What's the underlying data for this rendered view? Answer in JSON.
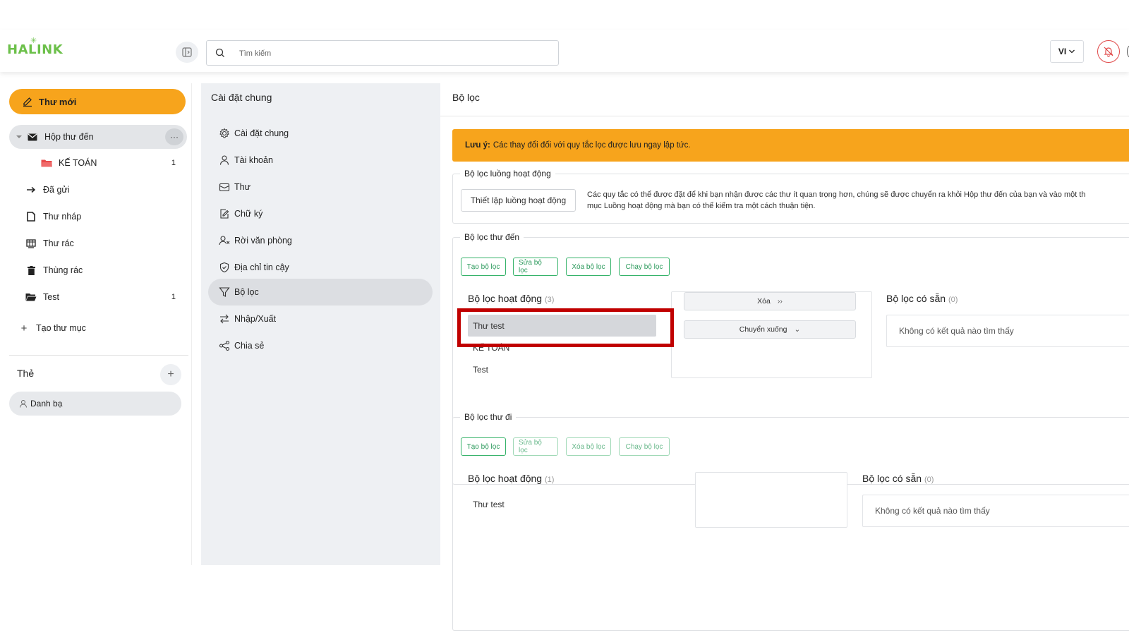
{
  "header": {
    "logo": "HALINK",
    "search_placeholder": "Tìm kiếm",
    "language": "VI"
  },
  "sidebar": {
    "new_mail": "Thư mới",
    "items": [
      {
        "label": "Hộp thư đến",
        "icon": "inbox-icon",
        "count": ""
      },
      {
        "label": "KẾ TOÁN",
        "icon": "folder-icon",
        "count": "1"
      },
      {
        "label": "Đã gửi",
        "icon": "sent-arrow-icon",
        "count": ""
      },
      {
        "label": "Thư nháp",
        "icon": "draft-icon",
        "count": ""
      },
      {
        "label": "Thư rác",
        "icon": "spam-icon",
        "count": ""
      },
      {
        "label": "Thùng rác",
        "icon": "trash-icon",
        "count": ""
      },
      {
        "label": "Test",
        "icon": "folder-open-icon",
        "count": "1"
      }
    ],
    "create_folder": "Tạo thư mục",
    "tags_title": "Thẻ",
    "contacts": "Danh bạ"
  },
  "settings": {
    "title": "Cài đặt chung",
    "items": [
      {
        "label": "Cài đặt chung",
        "icon": "gear-icon"
      },
      {
        "label": "Tài khoản",
        "icon": "user-icon"
      },
      {
        "label": "Thư",
        "icon": "mail-icon"
      },
      {
        "label": "Chữ ký",
        "icon": "signature-icon"
      },
      {
        "label": "Rời văn phòng",
        "icon": "user-away-icon"
      },
      {
        "label": "Địa chỉ tin cậy",
        "icon": "shield-icon"
      },
      {
        "label": "Bộ lọc",
        "icon": "filter-icon"
      },
      {
        "label": "Nhập/Xuất",
        "icon": "import-export-icon"
      },
      {
        "label": "Chia sẻ",
        "icon": "share-icon"
      }
    ]
  },
  "main": {
    "title": "Bộ lọc",
    "notice_label": "Lưu ý:",
    "notice_text": "Các thay đổi đối với quy tắc lọc được lưu ngay lập tức.",
    "flow": {
      "legend": "Bộ lọc luồng hoạt động",
      "button": "Thiết lập luồng hoạt động",
      "desc_line1": "Các quy tắc có thể được đặt để khi bạn nhận được các thư ít quan trọng hơn, chúng sẽ được chuyển ra khỏi Hộp thư đến của bạn và vào một th",
      "desc_line2": "mục Luồng hoạt động mà bạn có thể kiểm tra một cách thuận tiện."
    },
    "incoming": {
      "legend": "Bộ lọc thư đến",
      "buttons": [
        "Tạo bộ lọc",
        "Sửa bộ lọc",
        "Xóa bộ lọc",
        "Chạy bộ lọc"
      ],
      "active_title": "Bộ lọc hoạt động",
      "active_count": "(3)",
      "active_items": [
        "Thư test",
        "KẾ TOÁN",
        "Test"
      ],
      "action_delete": "Xóa",
      "action_move_down": "Chuyển xuống",
      "available_title": "Bộ lọc có sẵn",
      "available_count": "(0)",
      "empty_text": "Không có kết quả nào tìm thấy"
    },
    "outgoing": {
      "legend": "Bộ lọc thư đi",
      "buttons": [
        "Tạo bộ lọc",
        "Sửa bộ lọc",
        "Xóa bộ lọc",
        "Chạy bộ lọc"
      ],
      "active_title": "Bộ lọc hoạt động",
      "active_count": "(1)",
      "active_items": [
        "Thư test"
      ],
      "available_title": "Bộ lọc có sẵn",
      "available_count": "(0)",
      "empty_text": "Không có kết quả nào tìm thấy"
    }
  },
  "colors": {
    "accent": "#f7a41c",
    "green": "#36b36a",
    "highlight": "#c00000"
  }
}
